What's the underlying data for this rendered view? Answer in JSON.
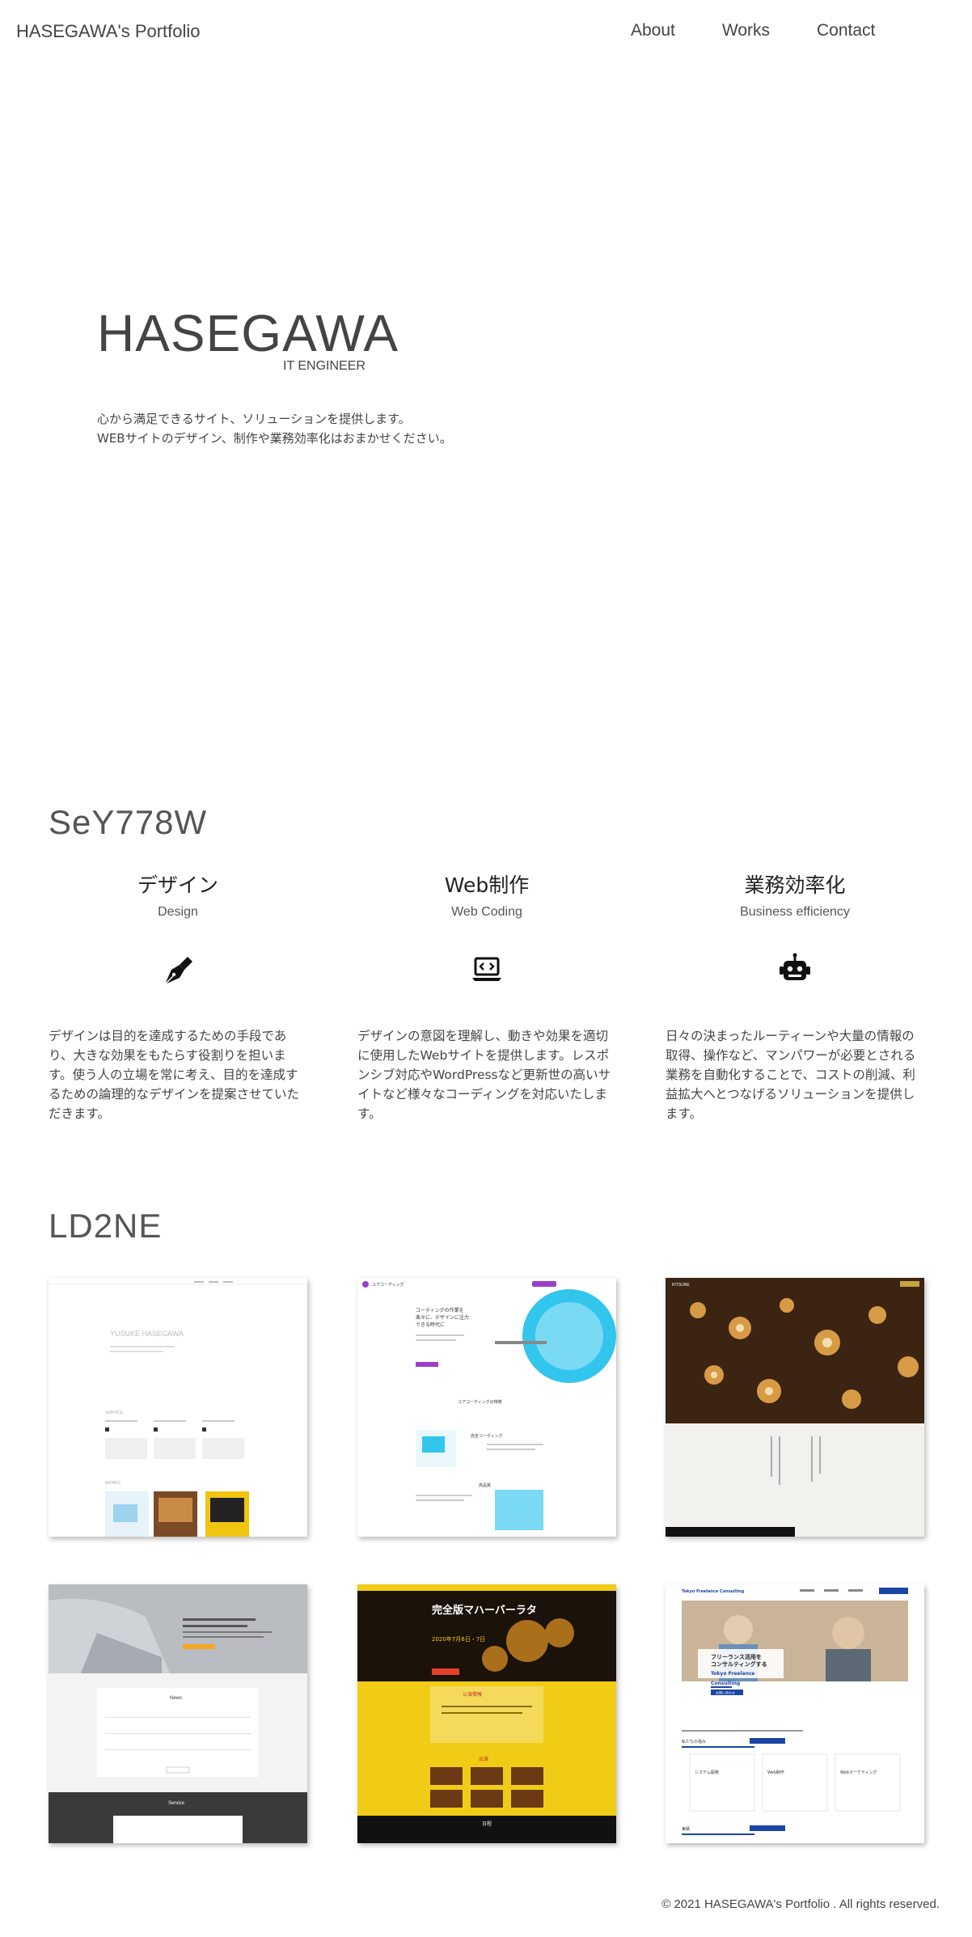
{
  "header": {
    "site_title": "HASEGAWA's Portfolio",
    "nav": [
      "About",
      "Works",
      "Contact"
    ]
  },
  "hero": {
    "name": "HASEGAWA",
    "subtitle": "IT ENGINEER",
    "lines": [
      "心から満足できるサイト、ソリューションを提供します。",
      "WEBサイトのデザイン、制作や業務効率化はおまかせください。"
    ]
  },
  "services": {
    "title": "SeY778W",
    "items": [
      {
        "title_ja": "デザイン",
        "title_en": "Design",
        "icon": "pen-nib-icon",
        "desc": "デザインは目的を達成するための手段であり、大きな効果をもたらす役割りを担います。使う人の立場を常に考え、目的を達成するための論理的なデザインを提案させていただきます。"
      },
      {
        "title_ja": "Web制作",
        "title_en": "Web Coding",
        "icon": "laptop-code-icon",
        "desc": "デザインの意図を理解し、動きや効果を適切に使用したWebサイトを提供します。レスポンシブ対応やWordPressなど更新世の高いサイトなど様々なコーディングを対応いたします。"
      },
      {
        "title_ja": "業務効率化",
        "title_en": "Business efficiency",
        "icon": "robot-icon",
        "desc": "日々の決まったルーティーンや大量の情報の取得、操作など、マンパワーが必要とされる業務を自動化することで、コストの削減、利益拡大へとつなげるソリューションを提供します。"
      }
    ]
  },
  "works": {
    "title": "LD2NE",
    "items": [
      {
        "thumb_text": [
          "YUSUKE HASEGAWA",
          "SERVICE",
          "WORKS"
        ]
      },
      {
        "thumb_text": [
          "ユアコーディング",
          "コーディングの作業を",
          "楽々に、デザインに注力",
          "できる時代に",
          "ユアコーディングの特徴",
          "完全コーディング",
          "高品質"
        ]
      },
      {
        "thumb_text": [
          "KITSUNE"
        ]
      },
      {
        "thumb_text": [
          "News",
          "Service"
        ]
      },
      {
        "thumb_text": [
          "完全版マハーバーラタ",
          "2020年7月6日・7日",
          "公演情報",
          "出演",
          "日程"
        ]
      },
      {
        "thumb_text": [
          "Tokyo Freelance Consulting",
          "フリーランス活用を",
          "コンサルティングする",
          "Tokyo Freelance",
          "Consulting",
          "お問い合わせ",
          "システム開発",
          "Web制作",
          "Webマーケティング",
          "私たちの強み",
          "実績"
        ]
      }
    ]
  },
  "footer": {
    "copyright": "© 2021 HASEGAWA's Portfolio . All rights reserved."
  },
  "colors": {
    "text": "#333333",
    "accent_purple": "#9b3ec9",
    "accent_yellow": "#f1c40f",
    "accent_blue": "#1a46a6"
  }
}
